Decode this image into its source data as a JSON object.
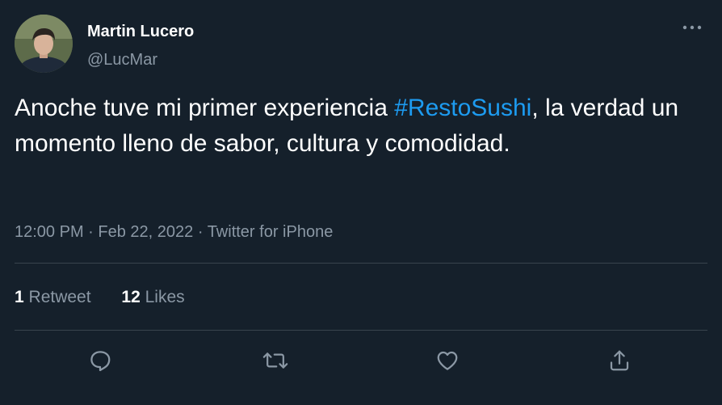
{
  "author": {
    "name": "Martin Lucero",
    "handle": "@LucMar"
  },
  "tweet": {
    "text_before": "Anoche tuve mi primer experiencia ",
    "hashtag": "#RestoSushi",
    "text_after": ", la verdad un momento lleno de sabor, cultura y comodidad.",
    "time": "12:00 PM",
    "date": "Feb 22, 2022",
    "source": "Twitter for iPhone",
    "separator": " · "
  },
  "stats": {
    "retweets_count": "1",
    "retweets_label": "Retweet",
    "likes_count": "12",
    "likes_label": "Likes"
  },
  "icons": {
    "more": "more-icon",
    "reply": "reply-icon",
    "retweet": "retweet-icon",
    "like": "like-icon",
    "share": "share-icon"
  },
  "colors": {
    "background": "#15202b",
    "text": "#ffffff",
    "secondary": "#8b98a5",
    "accent": "#1d9bf0",
    "divider": "#38444d"
  }
}
